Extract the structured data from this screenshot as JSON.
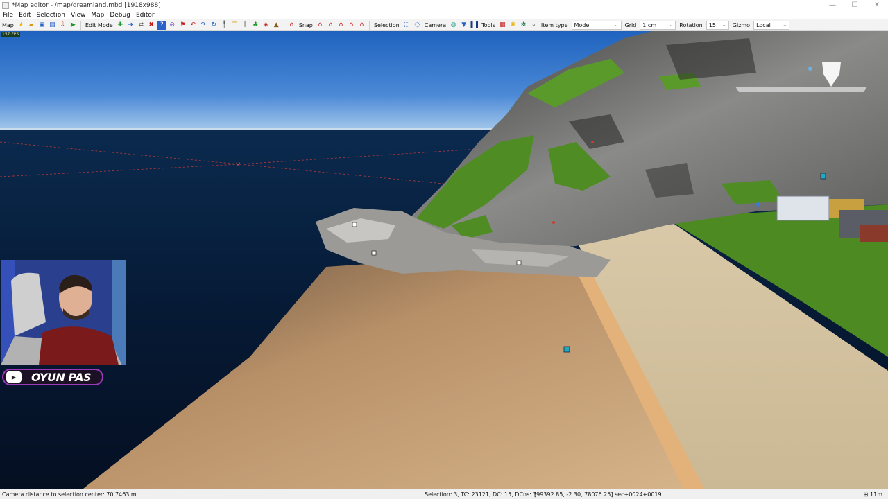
{
  "window": {
    "title": "*Map editor - /map/dreamland.mbd [1918x988]",
    "controls": {
      "minimize": "—",
      "maximize": "☐",
      "close": "✕"
    }
  },
  "menu": {
    "items": [
      "File",
      "Edit",
      "Selection",
      "View",
      "Map",
      "Debug",
      "Editor"
    ]
  },
  "toolbar": {
    "map_label": "Map",
    "edit_mode_label": "Edit Mode",
    "snap_label": "Snap",
    "selection_label": "Selection",
    "camera_label": "Camera",
    "tools_label": "Tools",
    "item_type_label": "Item type",
    "item_type_value": "Model",
    "grid_label": "Grid",
    "grid_value": "1 cm",
    "rotation_label": "Rotation",
    "rotation_value": "15",
    "gizmo_label": "Gizmo",
    "gizmo_value": "Local"
  },
  "viewport": {
    "fps": "157 FPS"
  },
  "overlay": {
    "channel_name": "OYUN PAS",
    "yt_glyph": "▶"
  },
  "status": {
    "camera_distance": "Camera distance to selection center: 70.7463 m",
    "selection_info": "Selection: 3, TC: 23121, DC: 15, DCns: 3",
    "coordinates": "[99392.85, -2.30, 78076.25] sec+0024+0019",
    "scale": "11m",
    "scale_glyph": "⊞"
  },
  "colors": {
    "sky_top": "#1f63bf",
    "sea": "#06142f",
    "grass": "#4d8a22",
    "rock": "#7a7a78",
    "sand": "#c9a878",
    "road": "#e0b27a",
    "badge_border": "#9b3ab8"
  }
}
